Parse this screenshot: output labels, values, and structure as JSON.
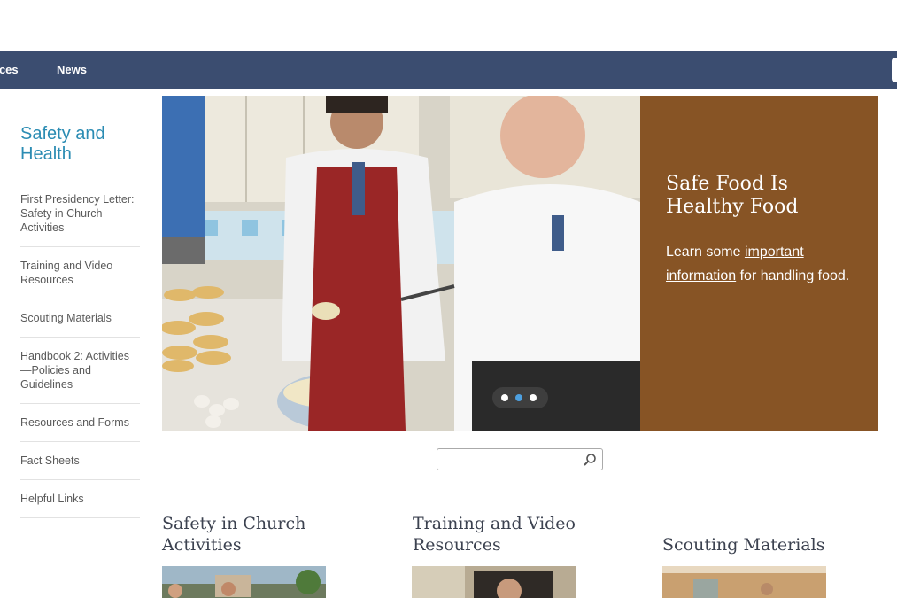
{
  "nav": {
    "items": [
      "ources",
      "News"
    ]
  },
  "sidebar": {
    "title": "Safety and Health",
    "items": [
      "First Presidency Letter: Safety in Church Activities",
      "Training and Video Resources",
      "Scouting Materials",
      "Handbook 2: Activities—Policies and Guidelines",
      "Resources and Forms",
      "Fact Sheets",
      "Helpful Links"
    ]
  },
  "hero": {
    "title": "Safe Food Is Healthy Food",
    "text_before": "Learn some ",
    "link_text": "important information",
    "text_after": " for handling food.",
    "slides": 3,
    "active_slide": 2
  },
  "search": {
    "value": "",
    "placeholder": ""
  },
  "sections": [
    {
      "title": "Safety in Church Activities"
    },
    {
      "title": "Training and Video Resources"
    },
    {
      "title": "Scouting Materials"
    }
  ],
  "colors": {
    "nav_bg": "#3b4d70",
    "sidebar_title": "#2b8cb3",
    "hero_panel": "#875425",
    "active_dot": "#4da0e0"
  }
}
